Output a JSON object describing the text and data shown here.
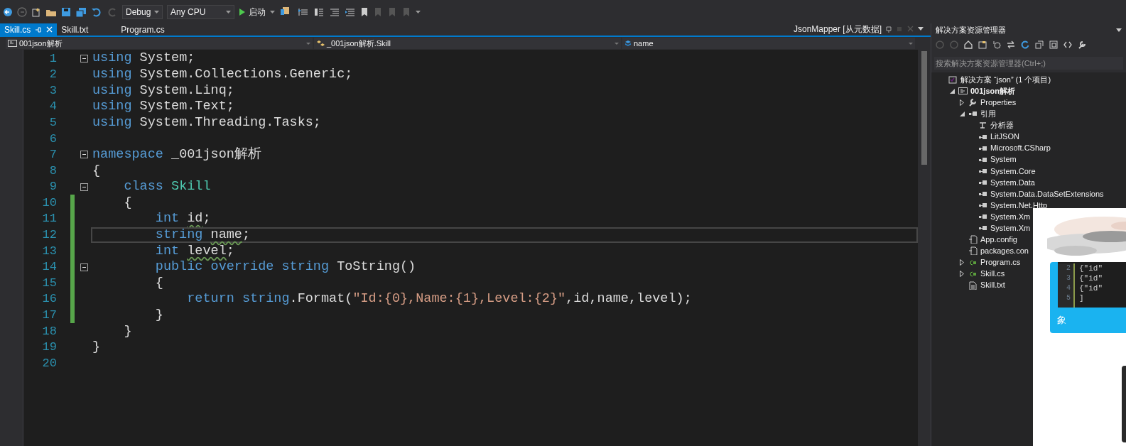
{
  "toolbar": {
    "configuration": "Debug",
    "platform": "Any CPU",
    "start": "启动"
  },
  "tabs": [
    {
      "label": "Skill.cs",
      "selected": true
    },
    {
      "label": "Skill.txt",
      "selected": false
    },
    {
      "label": "Program.cs",
      "selected": false
    }
  ],
  "preview_tab": {
    "label": "JsonMapper [从元数据]"
  },
  "navigation": {
    "project": "001json解析",
    "type": "_001json解析.Skill",
    "member": "name"
  },
  "editor": {
    "lines": [
      {
        "number": "1",
        "fold": true,
        "changed": false,
        "current": false,
        "tokens": [
          {
            "kind": "kw",
            "text": "using"
          },
          {
            "kind": "plain",
            "text": " System;"
          }
        ]
      },
      {
        "number": "2",
        "fold": false,
        "changed": false,
        "current": false,
        "tokens": [
          {
            "kind": "kw",
            "text": "using"
          },
          {
            "kind": "plain",
            "text": " System.Collections.Generic;"
          }
        ]
      },
      {
        "number": "3",
        "fold": false,
        "changed": false,
        "current": false,
        "tokens": [
          {
            "kind": "kw",
            "text": "using"
          },
          {
            "kind": "plain",
            "text": " System.Linq;"
          }
        ]
      },
      {
        "number": "4",
        "fold": false,
        "changed": false,
        "current": false,
        "tokens": [
          {
            "kind": "kw",
            "text": "using"
          },
          {
            "kind": "plain",
            "text": " System.Text;"
          }
        ]
      },
      {
        "number": "5",
        "fold": false,
        "changed": false,
        "current": false,
        "tokens": [
          {
            "kind": "kw",
            "text": "using"
          },
          {
            "kind": "plain",
            "text": " System.Threading.Tasks;"
          }
        ]
      },
      {
        "number": "6",
        "fold": false,
        "changed": false,
        "current": false
      },
      {
        "number": "7",
        "fold": true,
        "changed": false,
        "current": false,
        "tokens": [
          {
            "kind": "kw",
            "text": "namespace"
          },
          {
            "kind": "plain",
            "text": " _001json解析"
          }
        ]
      },
      {
        "number": "8",
        "fold": false,
        "changed": false,
        "current": false,
        "tokens": [
          {
            "kind": "plain",
            "text": "{"
          }
        ]
      },
      {
        "number": "9",
        "fold": true,
        "changed": false,
        "current": false,
        "tokens": [
          {
            "kind": "kw",
            "text": "    class"
          },
          {
            "kind": "type",
            "text": " Skill"
          }
        ]
      },
      {
        "number": "10",
        "fold": false,
        "changed": true,
        "current": false,
        "tokens": [
          {
            "kind": "plain",
            "text": "    {"
          }
        ]
      },
      {
        "number": "11",
        "fold": false,
        "changed": true,
        "current": false,
        "tokens": [
          {
            "kind": "kw",
            "text": "        int "
          },
          {
            "kind": "warn",
            "text": "id"
          },
          {
            "kind": "plain",
            "text": ";"
          }
        ]
      },
      {
        "number": "12",
        "fold": false,
        "changed": true,
        "current": true,
        "tokens": [
          {
            "kind": "kw",
            "text": "        string "
          },
          {
            "kind": "warn",
            "text": "name"
          },
          {
            "kind": "plain",
            "text": ";"
          }
        ]
      },
      {
        "number": "13",
        "fold": false,
        "changed": true,
        "current": false,
        "tokens": [
          {
            "kind": "kw",
            "text": "        int "
          },
          {
            "kind": "warn",
            "text": "level"
          },
          {
            "kind": "plain",
            "text": ";"
          }
        ]
      },
      {
        "number": "14",
        "fold": true,
        "changed": true,
        "current": false,
        "tokens": [
          {
            "kind": "kw",
            "text": "        public override string"
          },
          {
            "kind": "plain",
            "text": " ToString()"
          }
        ]
      },
      {
        "number": "15",
        "fold": false,
        "changed": true,
        "current": false,
        "tokens": [
          {
            "kind": "plain",
            "text": "        {"
          }
        ]
      },
      {
        "number": "16",
        "fold": false,
        "changed": true,
        "current": false,
        "tokens": [
          {
            "kind": "kw",
            "text": "            return string"
          },
          {
            "kind": "plain",
            "text": ".Format("
          },
          {
            "kind": "str",
            "text": "\"Id:{0},Name:{1},Level:{2}\""
          },
          {
            "kind": "plain",
            "text": ",id,name,level);"
          }
        ]
      },
      {
        "number": "17",
        "fold": false,
        "changed": true,
        "current": false,
        "tokens": [
          {
            "kind": "plain",
            "text": "        }"
          }
        ]
      },
      {
        "number": "18",
        "fold": false,
        "changed": false,
        "current": false,
        "tokens": [
          {
            "kind": "plain",
            "text": "    }"
          }
        ]
      },
      {
        "number": "19",
        "fold": false,
        "changed": false,
        "current": false,
        "tokens": [
          {
            "kind": "plain",
            "text": "}"
          }
        ]
      },
      {
        "number": "20",
        "fold": false,
        "changed": false,
        "current": false
      }
    ]
  },
  "solution_explorer": {
    "title": "解决方案资源管理器",
    "search": {
      "placeholder": "搜索解决方案资源管理器(Ctrl+;)"
    },
    "tree": [
      {
        "label": "解决方案 “json” (1 个项目)",
        "kind": "solution",
        "children": [
          {
            "label": "001json解析",
            "kind": "project",
            "bold": true,
            "expanded": true,
            "children": [
              {
                "label": "Properties",
                "kind": "wrench",
                "expanded": false
              },
              {
                "label": "引用",
                "kind": "reference",
                "expanded": true,
                "children": [
                  {
                    "label": "分析器",
                    "kind": "analyzer"
                  },
                  {
                    "label": "LitJSON",
                    "kind": "reference"
                  },
                  {
                    "label": "Microsoft.CSharp",
                    "kind": "reference"
                  },
                  {
                    "label": "System",
                    "kind": "reference"
                  },
                  {
                    "label": "System.Core",
                    "kind": "reference"
                  },
                  {
                    "label": "System.Data",
                    "kind": "reference"
                  },
                  {
                    "label": "System.Data.DataSetExtensions",
                    "kind": "reference"
                  },
                  {
                    "label": "System.Net.Http",
                    "kind": "reference"
                  },
                  {
                    "label": "System.Xm",
                    "kind": "reference"
                  },
                  {
                    "label": "System.Xm",
                    "kind": "reference"
                  }
                ]
              },
              {
                "label": "App.config",
                "kind": "config"
              },
              {
                "label": "packages.con",
                "kind": "config"
              },
              {
                "label": "Program.cs",
                "kind": "csharp",
                "expanded": false
              },
              {
                "label": "Skill.cs",
                "kind": "csharp",
                "expanded": false
              },
              {
                "label": "Skill.txt",
                "kind": "text"
              }
            ]
          }
        ]
      }
    ]
  },
  "overlay": {
    "code_lines": [
      {
        "number": "2",
        "text": "{\"id\""
      },
      {
        "number": "3",
        "text": "{\"id\""
      },
      {
        "number": "4",
        "text": "{\"id\""
      },
      {
        "number": "5",
        "text": "]"
      }
    ],
    "caption": "象"
  }
}
